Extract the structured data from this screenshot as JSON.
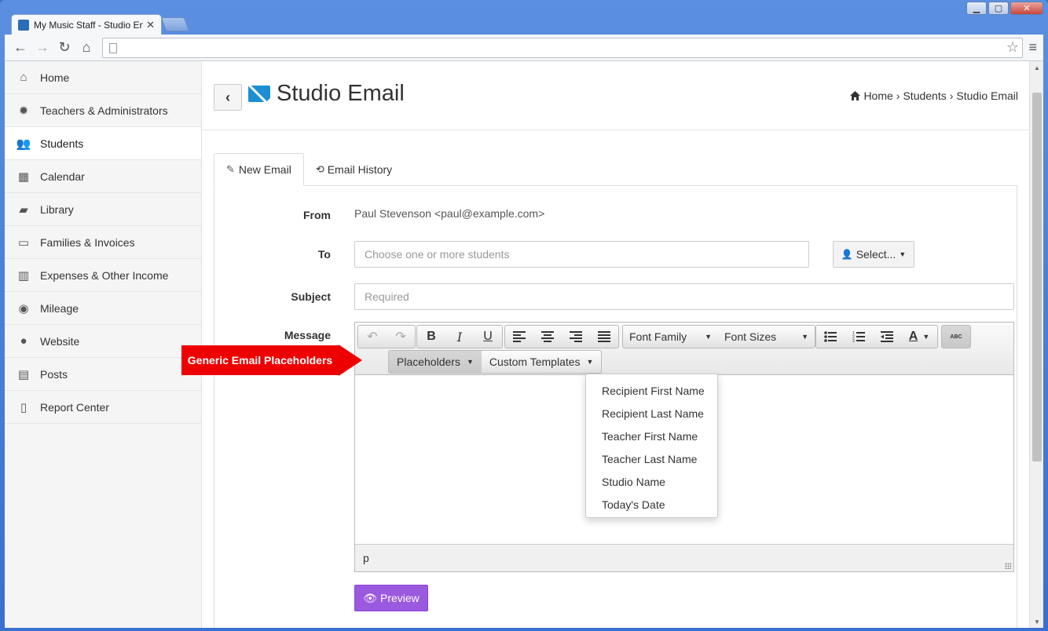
{
  "browser": {
    "tab_title": "My Music Staff - Studio En",
    "tab_close": "✕"
  },
  "sidebar": {
    "items": [
      {
        "label": "Home",
        "icon": "home-icon"
      },
      {
        "label": "Teachers & Administrators",
        "icon": "gear-icon"
      },
      {
        "label": "Students",
        "icon": "users-icon"
      },
      {
        "label": "Calendar",
        "icon": "calendar-icon"
      },
      {
        "label": "Library",
        "icon": "book-icon"
      },
      {
        "label": "Families & Invoices",
        "icon": "money-icon"
      },
      {
        "label": "Expenses & Other Income",
        "icon": "bar-chart-icon"
      },
      {
        "label": "Mileage",
        "icon": "dashboard-icon"
      },
      {
        "label": "Website",
        "icon": "globe-icon"
      },
      {
        "label": "Posts",
        "icon": "newspaper-icon"
      },
      {
        "label": "Report Center",
        "icon": "report-icon"
      }
    ],
    "active_index": 2
  },
  "header": {
    "title": "Studio Email",
    "breadcrumb": [
      "Home",
      "Students",
      "Studio Email"
    ],
    "breadcrumb_sep": "›"
  },
  "tabs": {
    "new_email": "New Email",
    "email_history": "Email History"
  },
  "form": {
    "from_label": "From",
    "from_value": "Paul Stevenson <paul@example.com>",
    "to_label": "To",
    "to_placeholder": "Choose one or more students",
    "select_label": "Select...",
    "subject_label": "Subject",
    "subject_placeholder": "Required",
    "message_label": "Message"
  },
  "editor": {
    "font_family": "Font Family",
    "font_sizes": "Font Sizes",
    "placeholders": "Placeholders",
    "custom_templates": "Custom Templates",
    "status_path": "p",
    "bold": "B",
    "italic": "I",
    "underline": "U",
    "text_color": "A",
    "spellcheck": "ABC"
  },
  "placeholders_menu": [
    "Recipient First Name",
    "Recipient Last Name",
    "Teacher First Name",
    "Teacher Last Name",
    "Studio Name",
    "Today's Date"
  ],
  "preview_label": "Preview",
  "annotation": "Generic Email Placeholders",
  "colors": {
    "accent_blue": "#1c8fd4",
    "preview_purple": "#9b59e0",
    "annotation_red": "#ee0000"
  }
}
